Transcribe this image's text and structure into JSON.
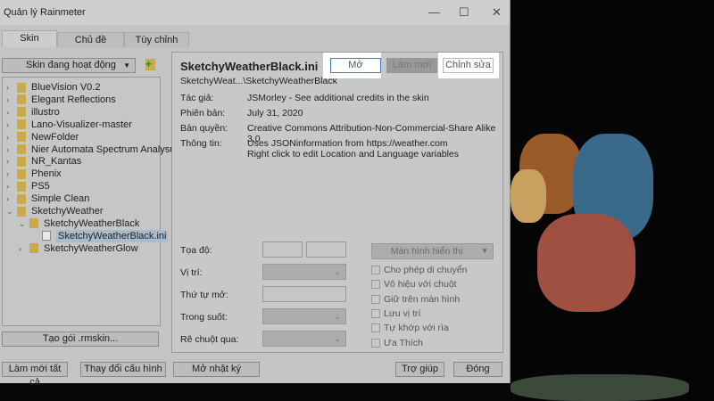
{
  "window": {
    "title": "Quản lý Rainmeter"
  },
  "tabs": [
    "Skin",
    "Chủ đề",
    "Tùy chỉnh"
  ],
  "left": {
    "dropdown": "Skin đang hoạt động",
    "create_button": "Tạo gói .rmskin...",
    "tree": [
      "BlueVision V0.2",
      "Elegant Reflections",
      "illustro",
      "Lano-Visualizer-master",
      "NewFolder",
      "Nier Automata Spectrum Analysur",
      "NR_Kantas",
      "Phenix",
      "PS5",
      "Simple Clean",
      "SketchyWeather",
      "SketchyWeatherBlack",
      "SketchyWeatherBlack.ini",
      "SketchyWeatherGlow"
    ]
  },
  "skin": {
    "name": "SketchyWeatherBlack.ini",
    "path": "SketchyWeat...\\SketchyWeatherBlack",
    "open": "Mở",
    "refresh": "Làm mới",
    "edit": "Chỉnh sửa",
    "labels": {
      "author": "Tác giả:",
      "version": "Phiên bản:",
      "license": "Bản quyền:",
      "info": "Thông tin:"
    },
    "author": "JSMorley - See additional credits in the skin",
    "version": "July 31, 2020",
    "license": "Creative Commons Attribution-Non-Commercial-Share Alike 3.0",
    "info1": "Uses JSONinformation from https://weather.com",
    "info2": "Right click to edit Location and Language variables"
  },
  "settings": {
    "coords": "Tọa độ:",
    "position": "Vị trí:",
    "load_order": "Thứ tự mở:",
    "transparency": "Trong suốt:",
    "hover": "Rê chuột qua:",
    "display": "Màn hình hiển thị",
    "checks": [
      "Cho phép di chuyển",
      "Vô hiệu với chuột",
      "Giữ trên màn hình",
      "Lưu vị trí",
      "Tự khớp với rìa",
      "Ưa Thích"
    ]
  },
  "bottom": {
    "refresh_all": "Làm mới tất cả",
    "change_layout": "Thay đổi cấu hình",
    "open_log": "Mở nhật ký",
    "help": "Trợ giúp",
    "close": "Đóng"
  }
}
